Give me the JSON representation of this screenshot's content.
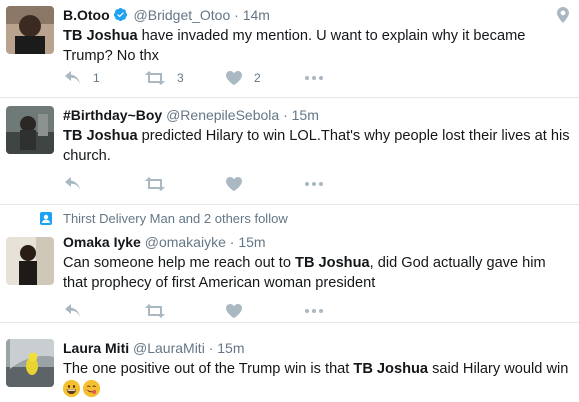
{
  "tweets": [
    {
      "name": "B.Otoo",
      "handle": "@Bridget_Otoo",
      "time": "14m",
      "verified": true,
      "text_parts": [
        "TB Joshua",
        " have invaded my mention. U want to explain why it became Trump? No thx"
      ],
      "replies": "1",
      "retweets": "3",
      "likes": "2"
    },
    {
      "name": "#Birthday~Boy",
      "handle": "@RenepileSebola",
      "time": "15m",
      "text_parts": [
        "TB Joshua",
        " predicted Hilary to win LOL.That's why people lost their lives at his church."
      ]
    },
    {
      "social_context": "Thirst Delivery Man and 2 others follow",
      "name": "Omaka Iyke",
      "handle": "@omakaiyke",
      "time": "15m",
      "text_parts": [
        "Can someone help me reach out to ",
        "TB Joshua",
        ", did God actually gave him that prophecy of first American woman president"
      ]
    },
    {
      "name": "Laura Miti",
      "handle": "@LauraMiti",
      "time": "15m",
      "text_parts": [
        "The one positive out of the Trump win is that ",
        "TB Joshua",
        " said Hilary would win"
      ],
      "emojis": [
        "grinning-face-emoji",
        "savoring-food-face-emoji"
      ]
    }
  ],
  "separator": "·",
  "icons": {
    "reply": "reply-icon",
    "retweet": "retweet-icon",
    "like": "heart-icon",
    "more": "more-icon",
    "verified": "verified-badge-icon",
    "location": "location-pin-icon",
    "follow": "follow-context-icon"
  },
  "colors": {
    "icon": "#aab8c2",
    "verified": "#1da1f2",
    "muted": "#657786",
    "text": "#14171a",
    "border": "#e1e8ed"
  }
}
